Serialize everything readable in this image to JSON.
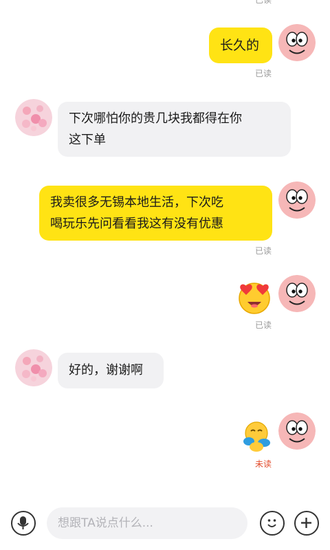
{
  "messages": {
    "m1": {
      "text": "长久的",
      "status": "已读"
    },
    "m2": {
      "line1": "下次哪怕你的贵几块我都得在你",
      "line2": "这下单"
    },
    "m3": {
      "line1": "我卖很多无锡本地生活，下次吃",
      "line2": "喝玩乐先问看看我这有没有优惠",
      "status": "已读"
    },
    "m4": {
      "sticker": "heart-eyes-emoji",
      "status": "已读"
    },
    "m5": {
      "text": "好的，谢谢啊"
    },
    "m6": {
      "sticker": "hug-emoji",
      "status": "未读"
    }
  },
  "top_partial_status": "已读",
  "input": {
    "placeholder": "想跟TA说点什么..."
  },
  "icons": {
    "mic": "mic-icon",
    "emoji": "emoji-icon",
    "plus": "plus-icon"
  },
  "colors": {
    "my_bubble": "#ffe314",
    "their_bubble": "#f1f1f3",
    "unread": "#e24b2b"
  }
}
